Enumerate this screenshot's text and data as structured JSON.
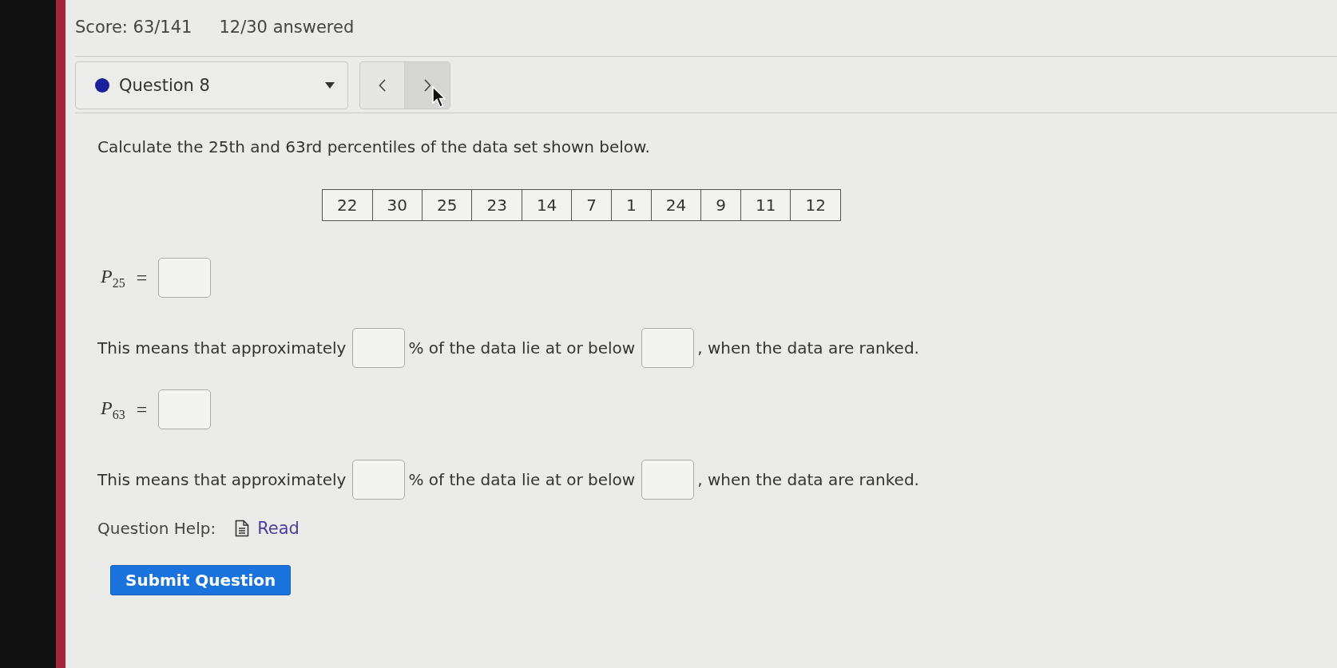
{
  "header": {
    "score": "Score: 63/141",
    "answered": "12/30 answered"
  },
  "question_nav": {
    "label": "Question 8",
    "buttons": [
      {
        "kind": "prev",
        "highlighted": false
      },
      {
        "kind": "next",
        "highlighted": true
      }
    ]
  },
  "question": {
    "prompt": "Calculate the 25th and 63rd percentiles of the data set shown below.",
    "data_table": [
      "22",
      "30",
      "25",
      "23",
      "14",
      "7",
      "1",
      "24",
      "9",
      "11",
      "12"
    ],
    "parts": [
      {
        "kind": "equation",
        "lhs": "*P*$_{25}$",
        "equals": "="
      },
      {
        "kind": "sentence",
        "texts": [
          "This means that approximately",
          "% of the data lie at or below",
          ", when the data are ranked."
        ]
      },
      {
        "kind": "equation",
        "lhs": "*P*$_{63}$",
        "equals": "="
      },
      {
        "kind": "sentence",
        "texts": [
          "This means that approximately",
          "% of the data lie at or below",
          ", when the data are ranked."
        ]
      }
    ],
    "help": {
      "label": "Question Help:",
      "link": "Read"
    },
    "submit": "Submit Question"
  }
}
